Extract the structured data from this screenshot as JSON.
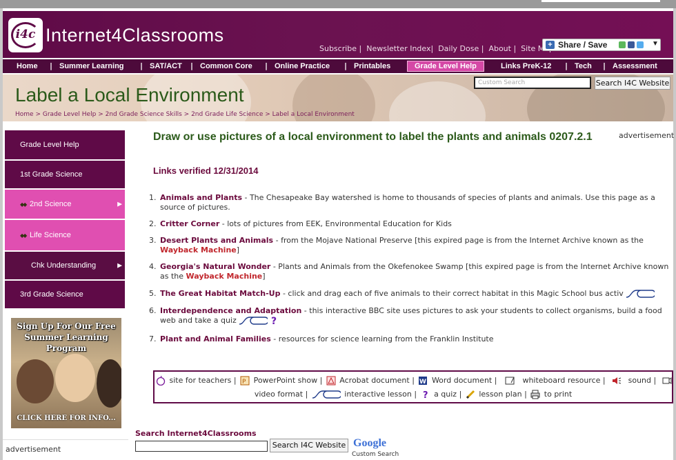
{
  "header": {
    "logo_text": "i4c",
    "site_title": "Internet4Classrooms",
    "top_links": [
      "Subscribe",
      "Newsletter Index",
      "Daily Dose",
      "About",
      "Site Map"
    ],
    "share_label": "Share / Save",
    "share_arrow": "▼"
  },
  "nav": {
    "items": [
      "Home",
      "Summer Learning",
      "SAT/ACT",
      "Common Core",
      "Online Practice",
      "Printables",
      "Grade Level Help",
      "Links PreK-12",
      "Tech",
      "Assessment"
    ],
    "active_index": 6,
    "separator": "|"
  },
  "banner": {
    "title": "Label a Local Environment",
    "search_placeholder": "Custom Search",
    "search_button": "Search I4C Website",
    "breadcrumb": [
      "Home",
      "Grade Level Help",
      "2nd Grade Science Skills",
      "2nd Grade Life Science",
      "Label a Local Environment"
    ],
    "breadcrumb_sep": ">"
  },
  "sidebar": {
    "items": [
      {
        "label": "Grade Level Help",
        "style": "normal"
      },
      {
        "label": "1st Grade Science",
        "style": "normal"
      },
      {
        "label": "2nd Science",
        "style": "pink",
        "marker": "◆◆",
        "arrow": "▶"
      },
      {
        "label": "Life Science",
        "style": "pink",
        "marker": "◆◆"
      },
      {
        "label": "Chk Understanding",
        "style": "dark",
        "arrow": "▶"
      },
      {
        "label": "3rd Grade Science",
        "style": "normal"
      }
    ],
    "promo_head": "Sign Up For Our Free Summer Learning Program",
    "promo_foot": "CLICK HERE FOR INFO...",
    "advertisement": "advertisement"
  },
  "main": {
    "heading": "Draw or use pictures of a local environment to label the plants and animals 0207.2.1",
    "verified": "Links verified 12/31/2014",
    "advertisement": "advertisement",
    "list": [
      {
        "num": "1.",
        "link": "Animals and Plants",
        "desc": " - The Chesapeake Bay watershed is home to thousands of species of plants and animals. Use this page as a source of pictures."
      },
      {
        "num": "2.",
        "link": "Critter Corner",
        "desc": " - lots of pictures from EEK, Environmental Education for Kids"
      },
      {
        "num": "3.",
        "link": "Desert Plants and Animals",
        "desc": " - from the Mojave National Preserve [this expired page is from the Internet Archive known as the ",
        "wayback": "Wayback Machine",
        "tail": "]"
      },
      {
        "num": "4.",
        "link": "Georgia's Natural Wonder",
        "desc": " - Plants and Animals from the Okefenokee Swamp [this expired page is from the Internet Archive known as the ",
        "wayback": "Wayback Machine",
        "tail": "]"
      },
      {
        "num": "5.",
        "link": "The Great Habitat Match-Up",
        "desc": " - click and drag each of five animals to their correct habitat in this Magic School bus activ"
      },
      {
        "num": "6.",
        "link": "Interdependence and Adaptation",
        "desc": " - this interactive BBC site uses pictures to ask your students to collect organisms, build a food web and take a quiz"
      },
      {
        "num": "7.",
        "link": "Plant and Animal Families",
        "desc": " - resources for science learning from the Franklin Institute"
      }
    ]
  },
  "legend": {
    "row1": [
      "site for teachers",
      "PowerPoint show",
      "Acrobat document",
      "Word document",
      "whiteboard resource",
      "sound"
    ],
    "row2": [
      "video format",
      "interactive lesson",
      "a quiz",
      "lesson plan",
      "to print"
    ],
    "separator": "|"
  },
  "bottom_search": {
    "label": "Search Internet4Classrooms",
    "button": "Search I4C Website",
    "google": "Google",
    "google_sub": "Custom Search"
  },
  "colors": {
    "brand_purple": "#5f0a47",
    "nav_active": "#d548a6",
    "title_green": "#2b5a1a",
    "link_maroon": "#6b0a3d",
    "wayback_red": "#c1272d"
  }
}
